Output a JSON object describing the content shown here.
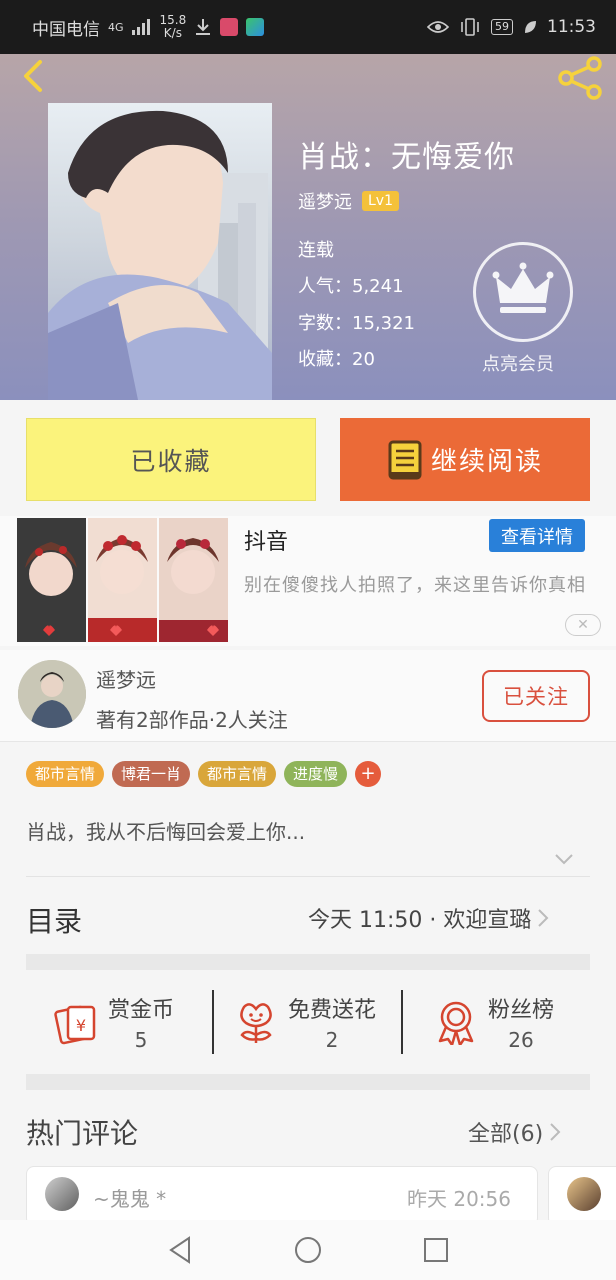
{
  "status_bar": {
    "carrier": "中国电信",
    "network": "4G",
    "speed_value": "15.8",
    "speed_unit": "K/s",
    "battery": "59",
    "time": "11:53"
  },
  "book": {
    "title": "肖战：无悔爱你",
    "author": "遥梦远",
    "level": "Lv1",
    "status": "连载",
    "popularity": "人气：5,241",
    "word_count": "字数：15,321",
    "favorites": "收藏：20",
    "vip_label": "点亮会员"
  },
  "actions": {
    "favorited_label": "已收藏",
    "continue_label": "继续阅读"
  },
  "ad": {
    "title": "抖音",
    "detail_button": "查看详情",
    "description": "别在傻傻找人拍照了，来这里告诉你真相",
    "close_label": "✕"
  },
  "author_box": {
    "name": "遥梦远",
    "info": "著有2部作品·2人关注",
    "follow_label": "已关注"
  },
  "tags": [
    {
      "label": "都市言情",
      "color": "#f0a93a"
    },
    {
      "label": "博君一肖",
      "color": "#c06a52"
    },
    {
      "label": "都市言情",
      "color": "#d9a63a"
    },
    {
      "label": "进度慢",
      "color": "#8fb45a"
    }
  ],
  "tag_add_label": "+",
  "intro": "肖战，我从不后悔回会爱上你...",
  "directory": {
    "title": "目录",
    "update": "今天 11:50 · 欢迎宣璐"
  },
  "stats": [
    {
      "label": "赏金币",
      "value": "5",
      "icon": "coin-envelope-icon"
    },
    {
      "label": "免费送花",
      "value": "2",
      "icon": "flower-icon"
    },
    {
      "label": "粉丝榜",
      "value": "26",
      "icon": "medal-icon"
    }
  ],
  "comments": {
    "title": "热门评论",
    "all_label": "全部(6)",
    "first": {
      "user": "~鬼鬼 *",
      "time": "昨天 20:56"
    }
  },
  "colors": {
    "accent_orange": "#eb6a37",
    "fav_yellow": "#fbf37c",
    "follow_red": "#d9503e",
    "detail_blue": "#2980d9"
  }
}
